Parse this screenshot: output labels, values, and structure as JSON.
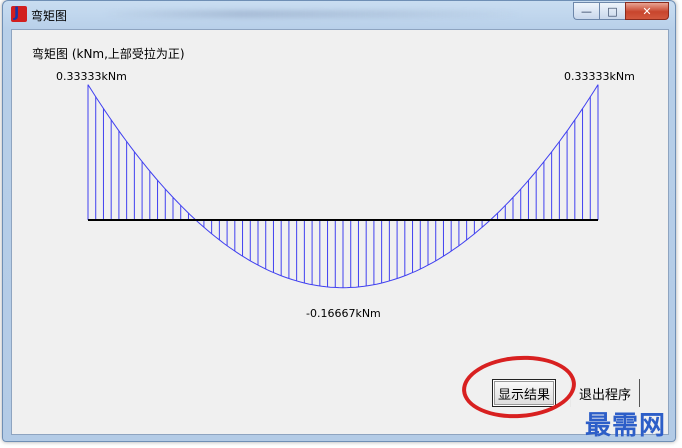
{
  "window": {
    "title": "弯矩图",
    "minimize_glyph": "—",
    "maximize_glyph": "□",
    "close_glyph": "✕"
  },
  "chart": {
    "title": "弯矩图 (kNm,上部受拉为正)",
    "left_label": "0.33333kNm",
    "right_label": "0.33333kNm",
    "min_label": "-0.16667kNm",
    "diagram_color": "#4040f0",
    "axis_color": "#000000"
  },
  "chart_data": {
    "type": "area",
    "x": [
      0,
      0.5,
      1
    ],
    "y": [
      0.33333,
      -0.16667,
      0.33333
    ],
    "ylabel": "",
    "xlabel": ""
  },
  "buttons": {
    "show_result": "显示结果",
    "exit_program": "退出程序"
  },
  "watermark": "最需网",
  "highlight_color": "#d82020"
}
